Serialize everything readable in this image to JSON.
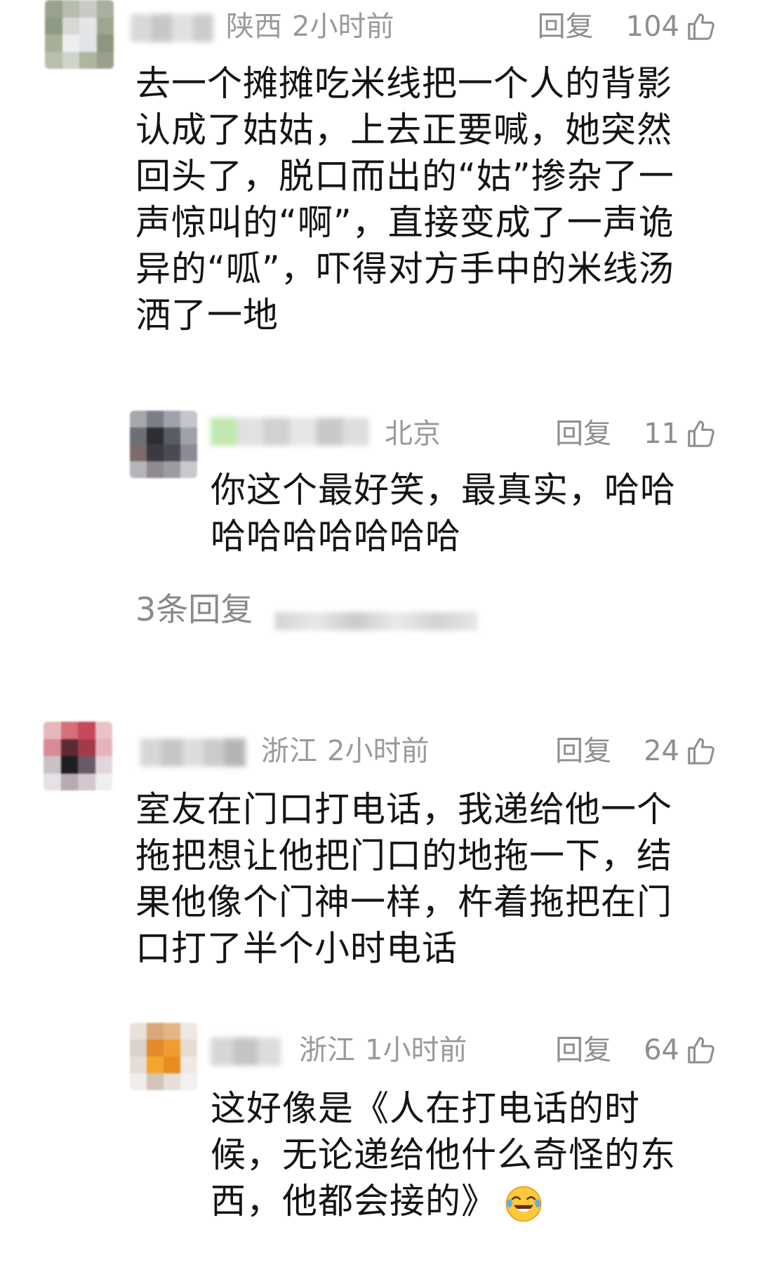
{
  "comments": [
    {
      "location": "陕西",
      "time": "2小时前",
      "reply_label": "回复",
      "likes": "104",
      "text_lines": [
        "去一个摊摊吃米线把一个人的背影",
        "认成了姑姑，上去正要喊，她突然",
        "回头了，脱口而出的“姑”掺杂了一",
        "声惊叫的“啊”，直接变成了一声诡",
        "异的“呱”，吓得对方手中的米线汤",
        "洒了一地"
      ],
      "reply": {
        "location": "北京",
        "reply_label": "回复",
        "likes": "11",
        "text_lines": [
          "你这个最好笑，最真实，哈哈",
          "哈哈哈哈哈哈哈"
        ]
      },
      "more_replies": "3条回复"
    },
    {
      "location": "浙江",
      "time": "2小时前",
      "reply_label": "回复",
      "likes": "24",
      "text_lines": [
        "室友在门口打电话，我递给他一个",
        "拖把想让他把门口的地拖一下，结",
        "果他像个门神一样，杵着拖把在门",
        "口打了半个小时电话"
      ],
      "reply": {
        "location": "浙江",
        "time": "1小时前",
        "reply_label": "回复",
        "likes": "64",
        "text_lines": [
          "这好像是《人在打电话的时",
          "候，无论递给他什么奇怪的东",
          "西，他都会接的》"
        ],
        "emoji": "tears-of-joy-emoji"
      }
    }
  ],
  "colors": {
    "text": "#141414",
    "meta": "#9a9a9a",
    "action": "#8e8e8e"
  },
  "icons": [
    "thumbs-up-icon",
    "tears-of-joy-emoji"
  ]
}
